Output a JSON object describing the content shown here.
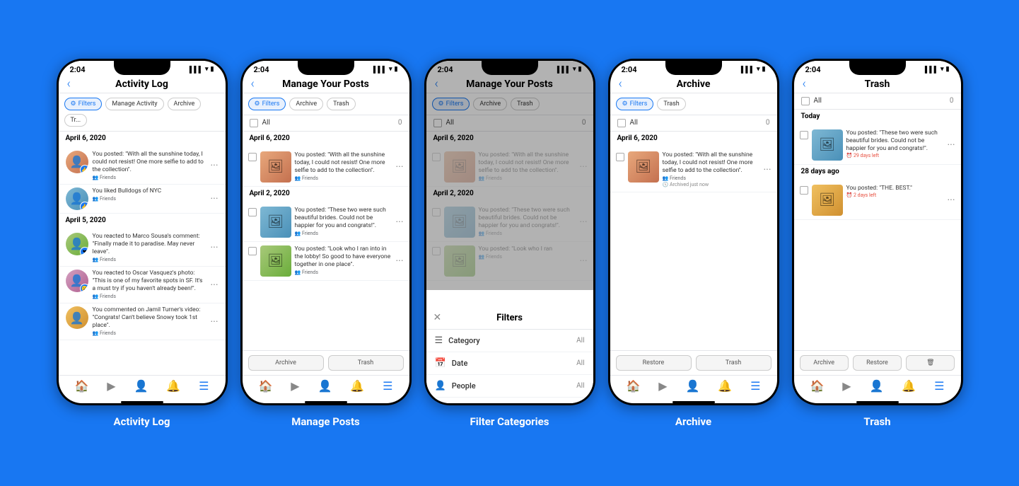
{
  "background": "#1877F2",
  "phones": [
    {
      "id": "activity-log",
      "label": "Activity Log",
      "header_title": "Activity Log",
      "has_back": true,
      "pills": [
        "Filters",
        "Manage Activity",
        "Archive",
        "Tr..."
      ],
      "pills_active": [
        0
      ],
      "has_all_row": false,
      "sections": [
        {
          "date": "April 6, 2020",
          "items": [
            {
              "type": "activity",
              "text": "You posted: \"With all the sunshine today, I could not resist! One more selfie to add to the collection\".",
              "privacy": "Friends",
              "avatar_class": "av1",
              "reaction": "👍"
            },
            {
              "type": "activity",
              "text": "You liked Bulldogs of NYC",
              "privacy": "Friends",
              "avatar_class": "av2",
              "reaction": "👍"
            }
          ]
        },
        {
          "date": "April 5, 2020",
          "items": [
            {
              "type": "activity",
              "text": "You reacted to Marco Sousa's comment: \"Finally made it to paradise. May never leave\".",
              "privacy": "Friends",
              "avatar_class": "av3",
              "reaction": "❤️"
            },
            {
              "type": "activity",
              "text": "You reacted to Oscar Vasquez's photo: \"This is one of my favorite spots in SF. It's a must try if you haven't already been!\".",
              "privacy": "Friends",
              "avatar_class": "av4",
              "reaction": "😮"
            },
            {
              "type": "activity",
              "text": "You commented on Jamil Turner's video: \"Congrats! Can't believe Snowy took 1st place\".",
              "privacy": "Friends",
              "avatar_class": "av5",
              "reaction": null
            }
          ]
        }
      ],
      "has_action_bar": false,
      "show_filter_overlay": false
    },
    {
      "id": "manage-posts",
      "label": "Manage Posts",
      "header_title": "Manage Your Posts",
      "has_back": true,
      "pills": [
        "Filters",
        "Archive",
        "Trash"
      ],
      "pills_active": [
        0
      ],
      "has_all_row": true,
      "all_count": "0",
      "sections": [
        {
          "date": "April 6, 2020",
          "items": [
            {
              "type": "post",
              "text": "You posted: \"With all the sunshine today, I could not resist! One more selfie to add to the collection\".",
              "privacy": "Friends",
              "avatar_class": "av1",
              "tag": null
            }
          ]
        },
        {
          "date": "April 2, 2020",
          "items": [
            {
              "type": "post",
              "text": "You posted: \"These two were such beautiful brides. Could not be happier for you and congrats!\".",
              "privacy": "Friends",
              "avatar_class": "av2",
              "tag": null
            },
            {
              "type": "post",
              "text": "You posted: \"Look who I ran into in the lobby! So good to have everyone together in one place\".",
              "privacy": "Friends",
              "avatar_class": "av3",
              "tag": null
            }
          ]
        }
      ],
      "has_action_bar": true,
      "action_btns": [
        "Archive",
        "Trash"
      ],
      "show_filter_overlay": false
    },
    {
      "id": "filter-categories",
      "label": "Filter Categories",
      "header_title": "Manage Your Posts",
      "has_back": true,
      "pills": [
        "Filters",
        "Archive",
        "Trash"
      ],
      "pills_active": [
        0
      ],
      "has_all_row": true,
      "all_count": "0",
      "sections": [
        {
          "date": "April 6, 2020",
          "items": [
            {
              "type": "post",
              "text": "You posted: \"With all the sunshine today, I could not resist! One more selfie to add to the collection\".",
              "privacy": "Friends",
              "avatar_class": "av1",
              "tag": null,
              "dimmed": true
            }
          ]
        },
        {
          "date": "April 2, 2020",
          "items": [
            {
              "type": "post",
              "text": "You posted: \"These two were such beautiful brides. Could not be happier for you and congrats!\".",
              "privacy": "Friends",
              "avatar_class": "av2",
              "tag": null,
              "dimmed": true
            },
            {
              "type": "post",
              "text": "You posted: \"Look who I ran",
              "privacy": "Friends",
              "avatar_class": "av3",
              "tag": null,
              "dimmed": true
            }
          ]
        }
      ],
      "has_action_bar": false,
      "show_filter_overlay": true,
      "filter_items": [
        {
          "icon": "☰",
          "label": "Category",
          "value": "All"
        },
        {
          "icon": "📅",
          "label": "Date",
          "value": "All"
        },
        {
          "icon": "👤",
          "label": "People",
          "value": "All"
        }
      ]
    },
    {
      "id": "archive",
      "label": "Archive",
      "header_title": "Archive",
      "has_back": true,
      "pills": [
        "Filters",
        "Trash"
      ],
      "pills_active": [
        0
      ],
      "has_all_row": true,
      "all_count": "0",
      "sections": [
        {
          "date": "April 6, 2020",
          "items": [
            {
              "type": "post",
              "text": "You posted: \"With all the sunshine today, I could not resist! One more selfie to add to the collection\".",
              "privacy": "Friends",
              "avatar_class": "av1",
              "tag": "archived",
              "tag_text": "Archived just now"
            }
          ]
        }
      ],
      "has_action_bar": true,
      "action_btns": [
        "Restore",
        "Trash"
      ],
      "show_filter_overlay": false
    },
    {
      "id": "trash",
      "label": "Trash",
      "header_title": "Trash",
      "has_back": true,
      "pills": [],
      "pills_active": [],
      "has_all_row": true,
      "all_count": "0",
      "sections": [
        {
          "date": "Today",
          "items": [
            {
              "type": "post",
              "text": "You posted: \"These two were such beautiful brides. Could not be happier for you and congrats!\".",
              "privacy": null,
              "avatar_class": "av2",
              "tag": "days",
              "tag_text": "29 days left"
            }
          ]
        },
        {
          "date": "28 days ago",
          "items": [
            {
              "type": "post",
              "text": "You posted: \"THE. BEST.\"",
              "privacy": null,
              "avatar_class": "av5",
              "tag": "days",
              "tag_text": "2 days left"
            }
          ]
        }
      ],
      "has_action_bar": true,
      "action_btns": [
        "Archive",
        "Restore",
        "🗑"
      ],
      "show_filter_overlay": false
    }
  ],
  "bottom_nav_icons": [
    "🏠",
    "▶",
    "👤",
    "🔔",
    "☰"
  ]
}
